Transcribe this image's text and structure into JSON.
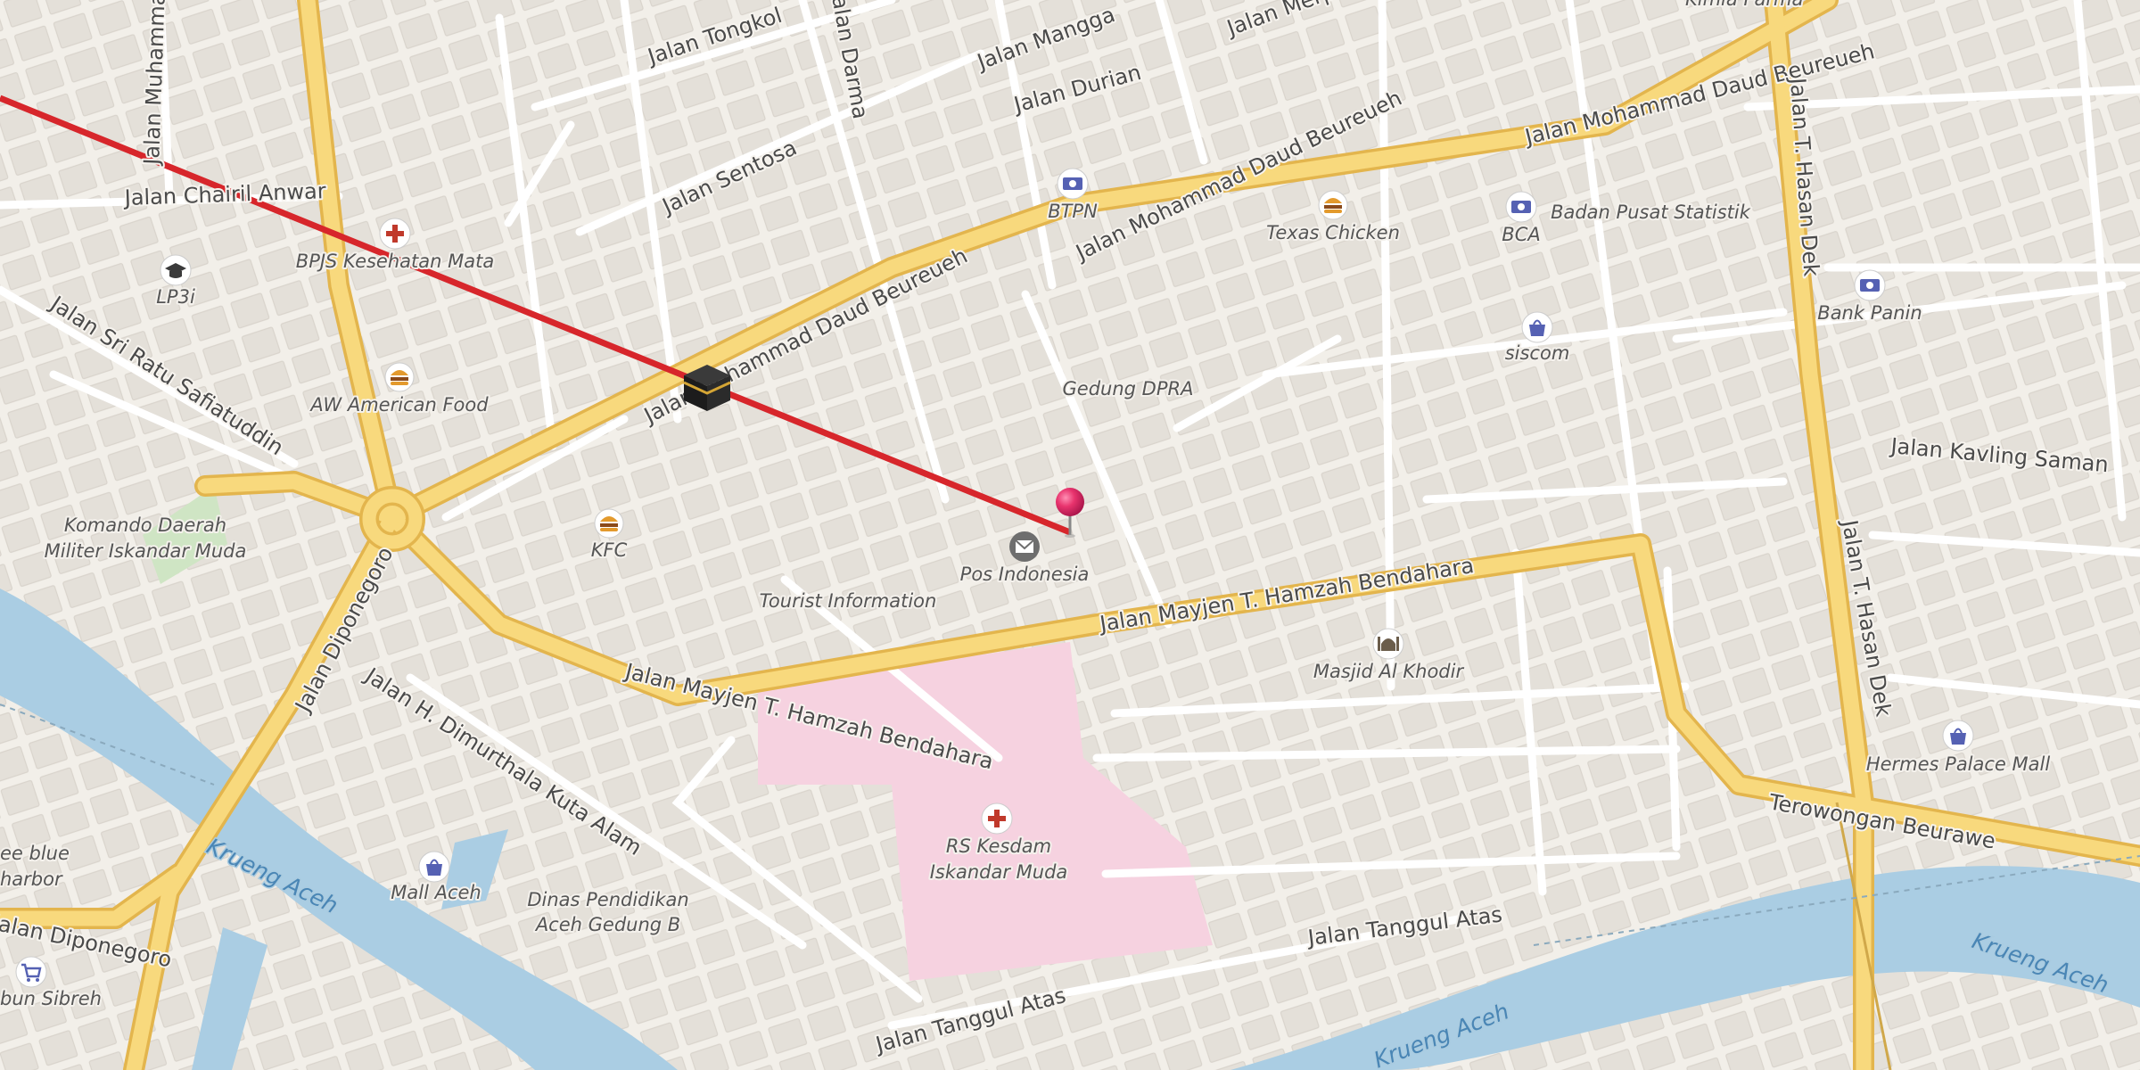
{
  "roads": {
    "daud_beureueh_west": "Jalan Mohammad Daud Beureueh",
    "daud_beureueh_mid": "Jalan Mohammad Daud Beureueh",
    "daud_beureueh_east": "Jalan Mohammad Daud Beureueh",
    "hamzah_west": "Jalan Mayjen T. Hamzah Bendahara",
    "hamzah_east": "Jalan Mayjen T. Hamzah Bendahara",
    "diponegoro": "Jalan Diponegoro",
    "diponegoro_west": "Jalan Diponegoro",
    "dimurthala": "Jalan H. Dimurthala Kuta Alam",
    "sri_ratu": "Jalan Sri Ratu Safiatuddin",
    "chairil": "Jalan Chairil Anwar",
    "daudsyah": "Jalan Muhammad Daudsyah",
    "tongkol": "Jalan Tongkol",
    "sentosa": "Jalan Sentosa",
    "mangga": "Jalan Mangga",
    "durian": "Jalan Durian",
    "merpati": "Jalan Merpati",
    "hasan_dek_north": "Jalan T. Hasan Dek",
    "hasan_dek_south": "Jalan T. Hasan Dek",
    "kavling": "Jalan Kavling Saman",
    "terowongan": "Terowongan Beurawe",
    "tanggul_east": "Jalan Tanggul Atas",
    "tanggul_west": "Jalan Tanggul Atas",
    "darma": "Jalan Darma"
  },
  "rivers": {
    "west": "Krueng Aceh",
    "south": "Krueng Aceh",
    "east": "Krueng Aceh"
  },
  "places": {
    "bpjs": "BPJS Kesehatan Mata",
    "lp3i": "LP3i",
    "aw": "AW American Food",
    "kodam_1": "Komando Daerah",
    "kodam_2": "Militer Iskandar Muda",
    "kfc": "KFC",
    "tourist": "Tourist Information",
    "pos": "Pos Indonesia",
    "btpn": "BTPN",
    "texas": "Texas Chicken",
    "bca": "BCA",
    "bps": "Badan Pusat Statistik",
    "dpra": "Gedung DPRA",
    "siscom": "siscom",
    "bank_panin": "Bank Panin",
    "masjid": "Masjid Al Khodir",
    "hermes": "Hermes Palace Mall",
    "rs_1": "RS Kesdam",
    "rs_2": "Iskandar Muda",
    "mall_aceh": "Mall Aceh",
    "dinas_1": "Dinas Pendidikan",
    "dinas_2": "Aceh Gedung B",
    "free_blue_1": "ee blue",
    "free_blue_2": "harbor",
    "kebun": "bun Sibreh",
    "top_partial": "Kimia Farma"
  },
  "icons": {
    "pin": "location-pin-icon",
    "kaaba": "kaaba-icon",
    "hospital": "hospital-cross-icon",
    "food": "burger-icon",
    "bank": "banknote-icon",
    "shop": "shopping-bag-icon",
    "post": "envelope-icon",
    "school": "graduation-cap-icon",
    "mosque": "mosque-icon",
    "cart": "shopping-cart-icon"
  },
  "colors": {
    "land": "#f2efe9",
    "building": "#e0dcd5",
    "major_road": "#f7d77c",
    "major_road_casing": "#e6b84f",
    "minor_road": "#ffffff",
    "water": "#aacde3",
    "hospital_area": "#f7d3e1",
    "park": "#cfe5c4",
    "qibla_line": "#d7262b",
    "pin": "#e8336d"
  }
}
